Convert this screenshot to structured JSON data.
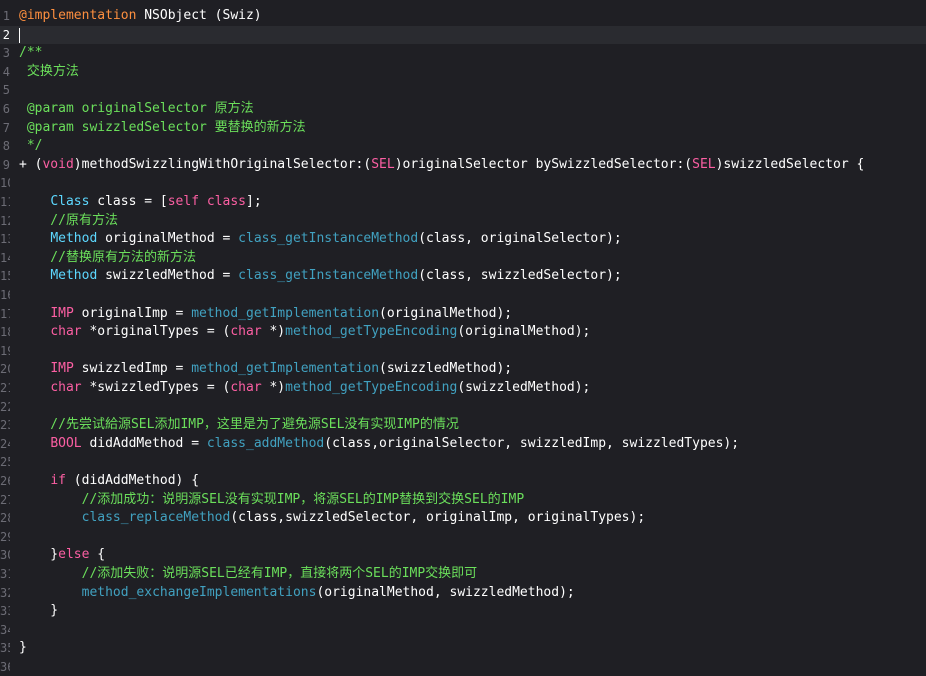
{
  "editor": {
    "language": "Objective-C",
    "colors": {
      "background": "#1f1f24",
      "current_line": "#2a2b30",
      "keyword": "#fc5fa3",
      "type": "#5dd8ff",
      "function": "#41a1c0",
      "plain": "#ffffff",
      "comment": "#6bdf5b",
      "directive": "#fd8f3f",
      "line_number": "#6c6c75"
    },
    "current_line_number": "2",
    "lines": [
      {
        "num": "1",
        "tokens": [
          {
            "t": "@implementation",
            "c": "at"
          },
          {
            "t": " NSObject (Swiz)",
            "c": "pl"
          }
        ]
      },
      {
        "num": "2",
        "tokens": []
      },
      {
        "num": "3",
        "tokens": [
          {
            "t": "/**",
            "c": "cm"
          }
        ]
      },
      {
        "num": "4",
        "tokens": [
          {
            "t": " 交换方法",
            "c": "cm"
          }
        ]
      },
      {
        "num": "5",
        "tokens": []
      },
      {
        "num": "6",
        "tokens": [
          {
            "t": " @param originalSelector 原方法",
            "c": "cm"
          }
        ]
      },
      {
        "num": "7",
        "tokens": [
          {
            "t": " @param swizzledSelector 要替换的新方法",
            "c": "cm"
          }
        ]
      },
      {
        "num": "8",
        "tokens": [
          {
            "t": " */",
            "c": "cm"
          }
        ]
      },
      {
        "num": "9",
        "tokens": [
          {
            "t": "+ (",
            "c": "pl"
          },
          {
            "t": "void",
            "c": "kw"
          },
          {
            "t": ")methodSwizzlingWithOriginalSelector:(",
            "c": "pl"
          },
          {
            "t": "SEL",
            "c": "kw"
          },
          {
            "t": ")originalSelector bySwizzledSelector:(",
            "c": "pl"
          },
          {
            "t": "SEL",
            "c": "kw"
          },
          {
            "t": ")swizzledSelector {",
            "c": "pl"
          }
        ]
      },
      {
        "num": "10",
        "tokens": []
      },
      {
        "num": "11",
        "tokens": [
          {
            "t": "    ",
            "c": "pl"
          },
          {
            "t": "Class",
            "c": "ty"
          },
          {
            "t": " class = [",
            "c": "pl"
          },
          {
            "t": "self",
            "c": "kw"
          },
          {
            "t": " ",
            "c": "pl"
          },
          {
            "t": "class",
            "c": "kw"
          },
          {
            "t": "];",
            "c": "pl"
          }
        ]
      },
      {
        "num": "12",
        "tokens": [
          {
            "t": "    //原有方法",
            "c": "cm"
          }
        ]
      },
      {
        "num": "13",
        "tokens": [
          {
            "t": "    ",
            "c": "pl"
          },
          {
            "t": "Method",
            "c": "ty"
          },
          {
            "t": " originalMethod = ",
            "c": "pl"
          },
          {
            "t": "class_getInstanceMethod",
            "c": "fn"
          },
          {
            "t": "(class, originalSelector);",
            "c": "pl"
          }
        ]
      },
      {
        "num": "14",
        "tokens": [
          {
            "t": "    //替换原有方法的新方法",
            "c": "cm"
          }
        ]
      },
      {
        "num": "15",
        "tokens": [
          {
            "t": "    ",
            "c": "pl"
          },
          {
            "t": "Method",
            "c": "ty"
          },
          {
            "t": " swizzledMethod = ",
            "c": "pl"
          },
          {
            "t": "class_getInstanceMethod",
            "c": "fn"
          },
          {
            "t": "(class, swizzledSelector);",
            "c": "pl"
          }
        ]
      },
      {
        "num": "16",
        "tokens": []
      },
      {
        "num": "17",
        "tokens": [
          {
            "t": "    ",
            "c": "pl"
          },
          {
            "t": "IMP",
            "c": "kw"
          },
          {
            "t": " originalImp = ",
            "c": "pl"
          },
          {
            "t": "method_getImplementation",
            "c": "fn"
          },
          {
            "t": "(originalMethod);",
            "c": "pl"
          }
        ]
      },
      {
        "num": "18",
        "tokens": [
          {
            "t": "    ",
            "c": "pl"
          },
          {
            "t": "char",
            "c": "kw"
          },
          {
            "t": " *originalTypes = (",
            "c": "pl"
          },
          {
            "t": "char",
            "c": "kw"
          },
          {
            "t": " *)",
            "c": "pl"
          },
          {
            "t": "method_getTypeEncoding",
            "c": "fn"
          },
          {
            "t": "(originalMethod);",
            "c": "pl"
          }
        ]
      },
      {
        "num": "19",
        "tokens": []
      },
      {
        "num": "20",
        "tokens": [
          {
            "t": "    ",
            "c": "pl"
          },
          {
            "t": "IMP",
            "c": "kw"
          },
          {
            "t": " swizzledImp = ",
            "c": "pl"
          },
          {
            "t": "method_getImplementation",
            "c": "fn"
          },
          {
            "t": "(swizzledMethod);",
            "c": "pl"
          }
        ]
      },
      {
        "num": "21",
        "tokens": [
          {
            "t": "    ",
            "c": "pl"
          },
          {
            "t": "char",
            "c": "kw"
          },
          {
            "t": " *swizzledTypes = (",
            "c": "pl"
          },
          {
            "t": "char",
            "c": "kw"
          },
          {
            "t": " *)",
            "c": "pl"
          },
          {
            "t": "method_getTypeEncoding",
            "c": "fn"
          },
          {
            "t": "(swizzledMethod);",
            "c": "pl"
          }
        ]
      },
      {
        "num": "22",
        "tokens": []
      },
      {
        "num": "23",
        "tokens": [
          {
            "t": "    //先尝试給源SEL添加IMP，这里是为了避免源SEL没有实现IMP的情况",
            "c": "cm"
          }
        ]
      },
      {
        "num": "24",
        "tokens": [
          {
            "t": "    ",
            "c": "pl"
          },
          {
            "t": "BOOL",
            "c": "kw"
          },
          {
            "t": " didAddMethod = ",
            "c": "pl"
          },
          {
            "t": "class_addMethod",
            "c": "fn"
          },
          {
            "t": "(class,originalSelector, swizzledImp, swizzledTypes);",
            "c": "pl"
          }
        ]
      },
      {
        "num": "25",
        "tokens": []
      },
      {
        "num": "26",
        "tokens": [
          {
            "t": "    ",
            "c": "pl"
          },
          {
            "t": "if",
            "c": "kw"
          },
          {
            "t": " (didAddMethod) {",
            "c": "pl"
          }
        ]
      },
      {
        "num": "27",
        "tokens": [
          {
            "t": "        //添加成功：说明源SEL没有实现IMP，将源SEL的IMP替换到交换SEL的IMP",
            "c": "cm"
          }
        ]
      },
      {
        "num": "28",
        "tokens": [
          {
            "t": "        ",
            "c": "pl"
          },
          {
            "t": "class_replaceMethod",
            "c": "fn"
          },
          {
            "t": "(class,swizzledSelector, originalImp, originalTypes);",
            "c": "pl"
          }
        ]
      },
      {
        "num": "29",
        "tokens": []
      },
      {
        "num": "30",
        "tokens": [
          {
            "t": "    }",
            "c": "pl"
          },
          {
            "t": "else",
            "c": "kw"
          },
          {
            "t": " {",
            "c": "pl"
          }
        ]
      },
      {
        "num": "31",
        "tokens": [
          {
            "t": "        //添加失败：说明源SEL已经有IMP，直接将两个SEL的IMP交换即可",
            "c": "cm"
          }
        ]
      },
      {
        "num": "32",
        "tokens": [
          {
            "t": "        ",
            "c": "pl"
          },
          {
            "t": "method_exchangeImplementations",
            "c": "fn"
          },
          {
            "t": "(originalMethod, swizzledMethod);",
            "c": "pl"
          }
        ]
      },
      {
        "num": "33",
        "tokens": [
          {
            "t": "    }",
            "c": "pl"
          }
        ]
      },
      {
        "num": "34",
        "tokens": []
      },
      {
        "num": "35",
        "tokens": [
          {
            "t": "}",
            "c": "pl"
          }
        ]
      },
      {
        "num": "36",
        "tokens": []
      }
    ]
  }
}
